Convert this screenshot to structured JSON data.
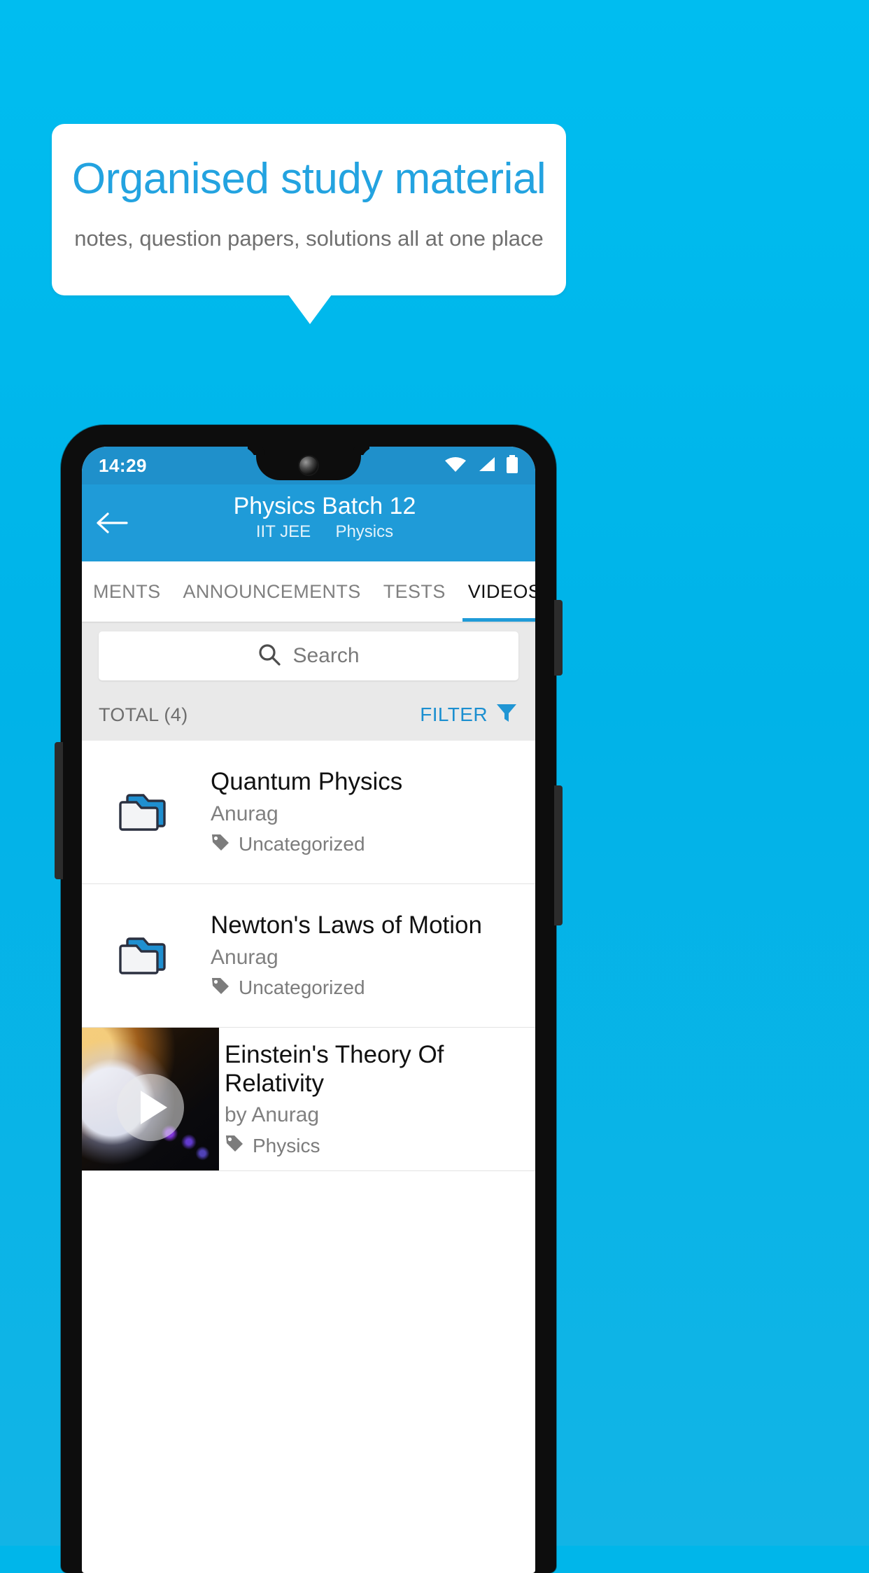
{
  "promo": {
    "title": "Organised study material",
    "subtitle": "notes, question papers, solutions all at one place",
    "accent_color": "#23a3e0",
    "background_color": "#00b6ea"
  },
  "phone": {
    "statusbar": {
      "time": "14:29",
      "icons": [
        "wifi-icon",
        "signal-icon",
        "battery-icon"
      ]
    },
    "appbar": {
      "back_icon": "back-arrow-icon",
      "title": "Physics Batch 12",
      "exam": "IIT JEE",
      "subject": "Physics",
      "color": "#1f9bd8"
    },
    "tabs": [
      {
        "label": "MENTS",
        "active": false
      },
      {
        "label": "ANNOUNCEMENTS",
        "active": false
      },
      {
        "label": "TESTS",
        "active": false
      },
      {
        "label": "VIDEOS",
        "active": true
      }
    ],
    "search": {
      "icon": "search-icon",
      "placeholder": "Search",
      "value": ""
    },
    "toolbar": {
      "total_label": "TOTAL (4)",
      "filter_label": "FILTER",
      "filter_icon": "funnel-icon"
    },
    "list": [
      {
        "kind": "folder",
        "icon": "folder-icon",
        "title": "Quantum Physics",
        "author": "Anurag",
        "tag": "Uncategorized",
        "tag_icon": "tag-icon"
      },
      {
        "kind": "folder",
        "icon": "folder-icon",
        "title": "Newton's Laws of Motion",
        "author": "Anurag",
        "tag": "Uncategorized",
        "tag_icon": "tag-icon"
      },
      {
        "kind": "video",
        "icon": "video-thumbnail",
        "play_icon": "play-icon",
        "title": "Einstein's Theory Of Relativity",
        "author": "by Anurag",
        "tag": "Physics",
        "tag_icon": "tag-icon"
      }
    ]
  }
}
